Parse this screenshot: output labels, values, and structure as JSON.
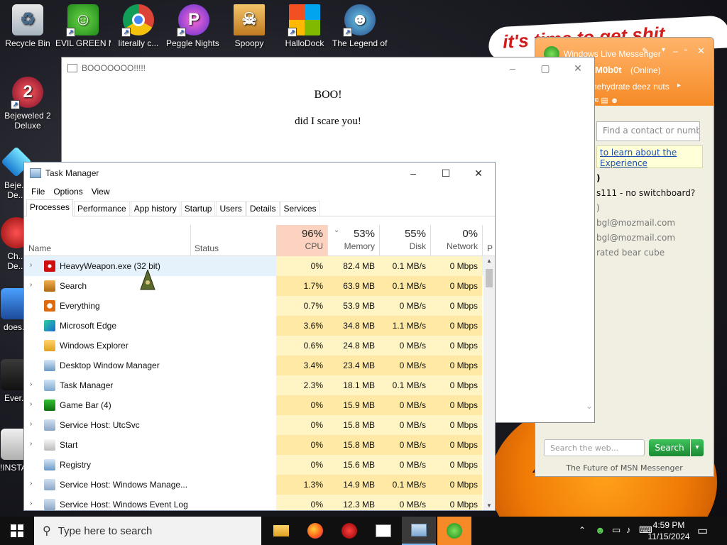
{
  "desktop": {
    "slogan": "it's time to get shit",
    "icons": [
      {
        "label": "Recycle Bin",
        "icon": "recycle-bin-icon"
      },
      {
        "label": "EVIL GREEN MSN CO...",
        "icon": "msn-icon"
      },
      {
        "label": "literally c...",
        "icon": "chrome-icon"
      },
      {
        "label": "Peggle Nights Del...",
        "icon": "peggle-icon"
      },
      {
        "label": "Spoopy",
        "icon": "spoopy-icon"
      },
      {
        "label": "HalloDock",
        "icon": "windows-logo-icon"
      },
      {
        "label": "The Legend of Titl...",
        "icon": "legend-icon"
      },
      {
        "label": "Bejeweled 2 Deluxe",
        "icon": "bejeweled-icon"
      },
      {
        "label": "Beje... De...",
        "icon": "gem-icon"
      },
      {
        "label": "Ch... De...",
        "icon": "ch-icon"
      },
      {
        "label": "does...",
        "icon": "does-icon"
      },
      {
        "label": "Ever...",
        "icon": "ever-icon"
      },
      {
        "label": "!INSTA...",
        "icon": "insta-icon"
      }
    ]
  },
  "boo_window": {
    "title": "BOOOOOOO!!!!!",
    "heading": "BOO!",
    "message": "did I scare you!"
  },
  "msn": {
    "title": "Windows Live Messenger",
    "username": "M0b0t",
    "status": "(Online)",
    "personal_message": "hehydrate deez nuts",
    "search_placeholder": "Find a contact or number...",
    "banner_line1": "to learn about the",
    "banner_line2": "Experience",
    "contacts": [
      ")",
      "s111 - no switchboard?",
      ")",
      "bgl@mozmail.com",
      "bgl@mozmail.com",
      "rated bear cube"
    ],
    "web_search_placeholder": "Search the web...",
    "search_button": "Search",
    "footer": "The Future of MSN Messenger"
  },
  "task_manager": {
    "title": "Task Manager",
    "menu": [
      "File",
      "Options",
      "View"
    ],
    "tabs": [
      "Processes",
      "Performance",
      "App history",
      "Startup",
      "Users",
      "Details",
      "Services"
    ],
    "active_tab": "Processes",
    "columns": {
      "name": "Name",
      "status": "Status",
      "cpu": {
        "pct": "96%",
        "label": "CPU"
      },
      "memory": {
        "pct": "53%",
        "label": "Memory"
      },
      "disk": {
        "pct": "55%",
        "label": "Disk"
      },
      "network": {
        "pct": "0%",
        "label": "Network"
      },
      "overflow": "P"
    },
    "processes": [
      {
        "name": "HeavyWeapon.exe (32 bit)",
        "expand": true,
        "icon": "heavyweapon-icon",
        "cpu": "0%",
        "mem": "82.4 MB",
        "disk": "0.1 MB/s",
        "net": "0 Mbps",
        "selected": true
      },
      {
        "name": "Search",
        "expand": true,
        "icon": "search-app-icon",
        "cpu": "1.7%",
        "mem": "63.9 MB",
        "disk": "0.1 MB/s",
        "net": "0 Mbps"
      },
      {
        "name": "Everything",
        "expand": false,
        "icon": "everything-icon",
        "cpu": "0.7%",
        "mem": "53.9 MB",
        "disk": "0 MB/s",
        "net": "0 Mbps"
      },
      {
        "name": "Microsoft Edge",
        "expand": false,
        "icon": "edge-icon",
        "cpu": "3.6%",
        "mem": "34.8 MB",
        "disk": "1.1 MB/s",
        "net": "0 Mbps"
      },
      {
        "name": "Windows Explorer",
        "expand": false,
        "icon": "explorer-icon",
        "cpu": "0.6%",
        "mem": "24.8 MB",
        "disk": "0 MB/s",
        "net": "0 Mbps"
      },
      {
        "name": "Desktop Window Manager",
        "expand": false,
        "icon": "dwm-icon",
        "cpu": "3.4%",
        "mem": "23.4 MB",
        "disk": "0 MB/s",
        "net": "0 Mbps"
      },
      {
        "name": "Task Manager",
        "expand": true,
        "icon": "taskmanager-icon",
        "cpu": "2.3%",
        "mem": "18.1 MB",
        "disk": "0.1 MB/s",
        "net": "0 Mbps"
      },
      {
        "name": "Game Bar (4)",
        "expand": true,
        "icon": "gamebar-icon",
        "cpu": "0%",
        "mem": "15.9 MB",
        "disk": "0 MB/s",
        "net": "0 Mbps"
      },
      {
        "name": "Service Host: UtcSvc",
        "expand": true,
        "icon": "service-host-icon",
        "cpu": "0%",
        "mem": "15.8 MB",
        "disk": "0 MB/s",
        "net": "0 Mbps"
      },
      {
        "name": "Start",
        "expand": true,
        "icon": "start-app-icon",
        "cpu": "0%",
        "mem": "15.8 MB",
        "disk": "0 MB/s",
        "net": "0 Mbps"
      },
      {
        "name": "Registry",
        "expand": false,
        "icon": "registry-icon",
        "cpu": "0%",
        "mem": "15.6 MB",
        "disk": "0 MB/s",
        "net": "0 Mbps"
      },
      {
        "name": "Service Host: Windows Manage...",
        "expand": true,
        "icon": "service-host-icon",
        "cpu": "1.3%",
        "mem": "14.9 MB",
        "disk": "0.1 MB/s",
        "net": "0 Mbps"
      },
      {
        "name": "Service Host: Windows Event Log",
        "expand": true,
        "icon": "service-host-icon",
        "cpu": "0%",
        "mem": "12.3 MB",
        "disk": "0 MB/s",
        "net": "0 Mbps"
      }
    ]
  },
  "taskbar": {
    "search_placeholder": "Type here to search",
    "time": "4:59 PM",
    "date": "11/15/2024"
  },
  "colors": {
    "accent_orange": "#f58a26",
    "cpu_header": "#fbd3c0",
    "heat_light": "#fff4c4",
    "heat_mid": "#ffe9a4",
    "taskbar": "#101010",
    "selection": "#e5f1fb"
  }
}
